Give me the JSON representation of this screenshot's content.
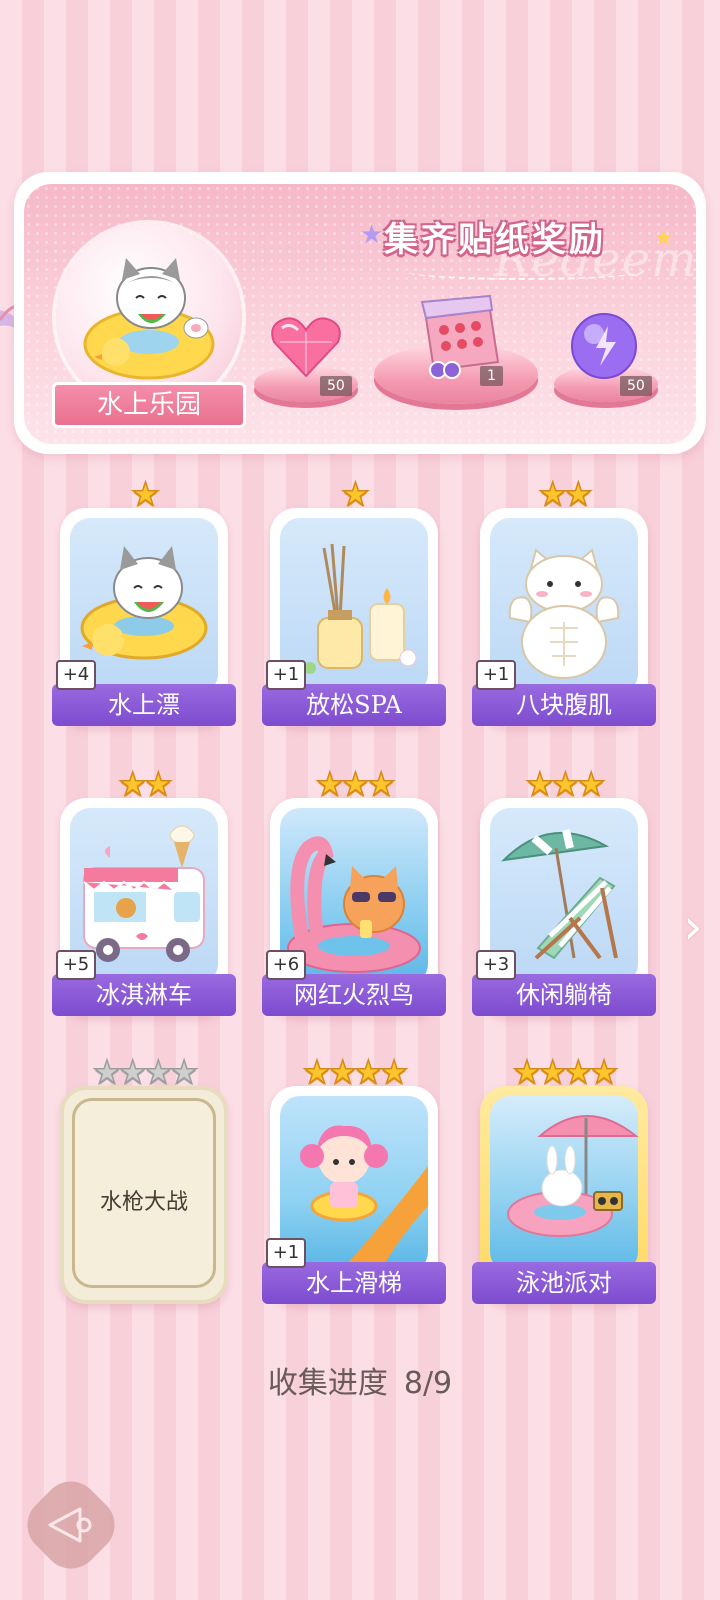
{
  "banner": {
    "title": "集齐贴纸奖励",
    "theme_label": "水上乐园",
    "rewards": [
      {
        "name": "heart-gem",
        "count": "50"
      },
      {
        "name": "gift-box",
        "count": "1"
      },
      {
        "name": "energy-orb",
        "count": "50"
      }
    ]
  },
  "stickers": [
    {
      "name": "水上漂",
      "stars": 1,
      "count": "+4",
      "art": "cat-float"
    },
    {
      "name": "放松SPA",
      "stars": 1,
      "count": "+1",
      "art": "spa"
    },
    {
      "name": "八块腹肌",
      "stars": 2,
      "count": "+1",
      "art": "muscle-cat"
    },
    {
      "name": "冰淇淋车",
      "stars": 2,
      "count": "+5",
      "art": "icecream-truck"
    },
    {
      "name": "网红火烈鸟",
      "stars": 3,
      "count": "+6",
      "art": "flamingo"
    },
    {
      "name": "休闲躺椅",
      "stars": 3,
      "count": "+3",
      "art": "beach-chair"
    },
    {
      "name": "水枪大战",
      "stars": 4,
      "count": "",
      "art": "locked"
    },
    {
      "name": "水上滑梯",
      "stars": 4,
      "count": "+1",
      "art": "water-slide"
    },
    {
      "name": "泳池派对",
      "stars": 4,
      "count": "",
      "art": "pool-party"
    }
  ],
  "progress": {
    "label": "收集进度",
    "value": "8/9"
  },
  "colors": {
    "accent_purple": "#8a5ad8",
    "pink": "#f58eab",
    "star_gold": "#ffc62b"
  }
}
